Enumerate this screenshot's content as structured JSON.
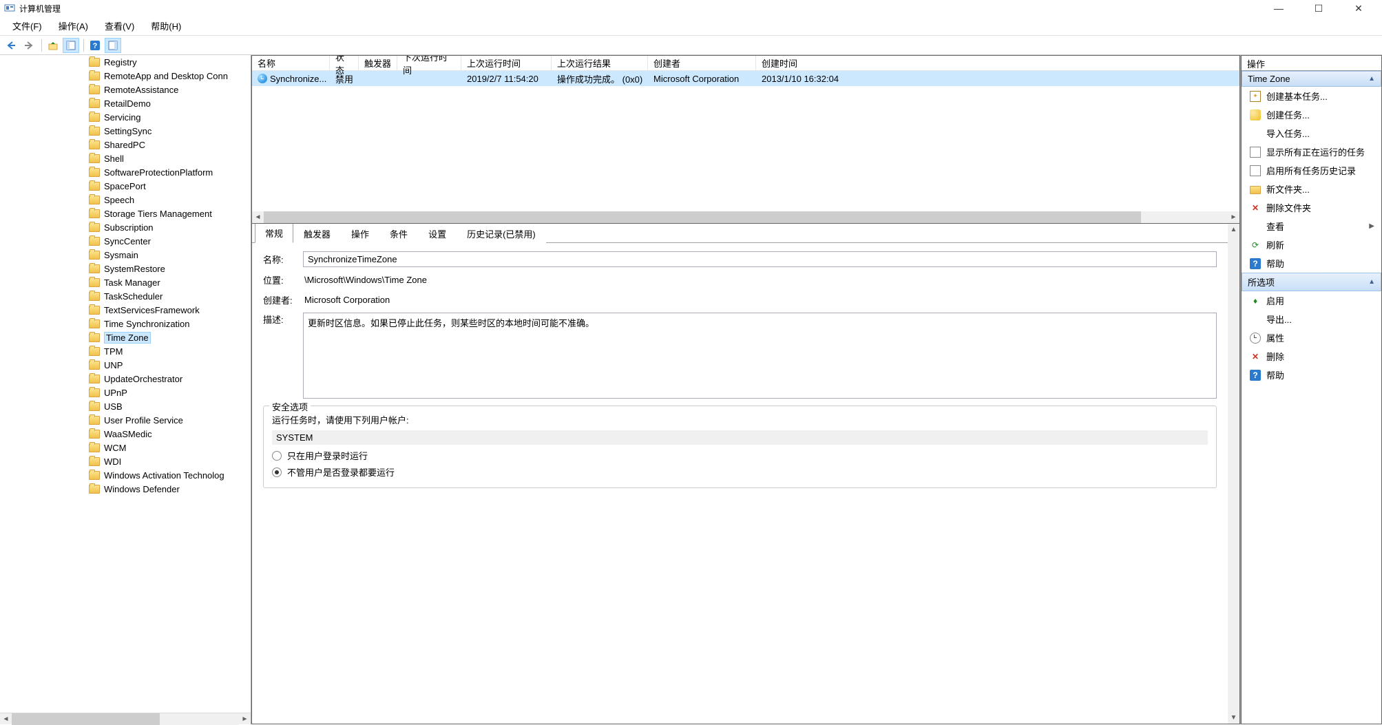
{
  "title": "计算机管理",
  "menu": [
    "文件(F)",
    "操作(A)",
    "查看(V)",
    "帮助(H)"
  ],
  "tree": {
    "items": [
      "Registry",
      "RemoteApp and Desktop Conn",
      "RemoteAssistance",
      "RetailDemo",
      "Servicing",
      "SettingSync",
      "SharedPC",
      "Shell",
      "SoftwareProtectionPlatform",
      "SpacePort",
      "Speech",
      "Storage Tiers Management",
      "Subscription",
      "SyncCenter",
      "Sysmain",
      "SystemRestore",
      "Task Manager",
      "TaskScheduler",
      "TextServicesFramework",
      "Time Synchronization",
      "Time Zone",
      "TPM",
      "UNP",
      "UpdateOrchestrator",
      "UPnP",
      "USB",
      "User Profile Service",
      "WaaSMedic",
      "WCM",
      "WDI",
      "Windows Activation Technolog",
      "Windows Defender"
    ],
    "selected": "Time Zone"
  },
  "tasklist": {
    "columns": [
      "名称",
      "状态",
      "触发器",
      "下次运行时间",
      "上次运行时间",
      "上次运行结果",
      "创建者",
      "创建时间"
    ],
    "rows": [
      {
        "name": "Synchronize...",
        "status": "禁用",
        "trigger": "",
        "next": "",
        "last": "2019/2/7 11:54:20",
        "result": "操作成功完成。 (0x0)",
        "creator": "Microsoft Corporation",
        "created": "2013/1/10 16:32:04"
      }
    ]
  },
  "tabs": [
    "常规",
    "触发器",
    "操作",
    "条件",
    "设置",
    "历史记录(已禁用)"
  ],
  "general": {
    "name_label": "名称:",
    "name": "SynchronizeTimeZone",
    "location_label": "位置:",
    "location": "\\Microsoft\\Windows\\Time Zone",
    "creator_label": "创建者:",
    "creator": "Microsoft Corporation",
    "desc_label": "描述:",
    "desc": "更新时区信息。如果已停止此任务，则某些时区的本地时间可能不准确。",
    "security_title": "安全选项",
    "security_prompt": "运行任务时，请使用下列用户帐户:",
    "account": "SYSTEM",
    "radio1": "只在用户登录时运行",
    "radio2": "不管用户是否登录都要运行"
  },
  "actions": {
    "title": "操作",
    "sections": [
      {
        "header": "Time Zone",
        "items": [
          {
            "icon": "task",
            "label": "创建基本任务..."
          },
          {
            "icon": "newtask",
            "label": "创建任务..."
          },
          {
            "icon": "",
            "label": "导入任务..."
          },
          {
            "icon": "display",
            "label": "显示所有正在运行的任务"
          },
          {
            "icon": "history",
            "label": "启用所有任务历史记录"
          },
          {
            "icon": "folder",
            "label": "新文件夹..."
          },
          {
            "icon": "delete",
            "glyph": "✕",
            "label": "删除文件夹"
          },
          {
            "icon": "",
            "label": "查看",
            "arrow": true
          },
          {
            "icon": "refresh",
            "glyph": "⟳",
            "label": "刷新"
          },
          {
            "icon": "help",
            "glyph": "?",
            "label": "帮助"
          }
        ]
      },
      {
        "header": "所选项",
        "items": [
          {
            "icon": "enable",
            "glyph": "♦",
            "label": "启用"
          },
          {
            "icon": "export",
            "label": "导出..."
          },
          {
            "icon": "prop",
            "label": "属性"
          },
          {
            "icon": "delete",
            "glyph": "✕",
            "label": "删除"
          },
          {
            "icon": "help",
            "glyph": "?",
            "label": "帮助"
          }
        ]
      }
    ]
  }
}
